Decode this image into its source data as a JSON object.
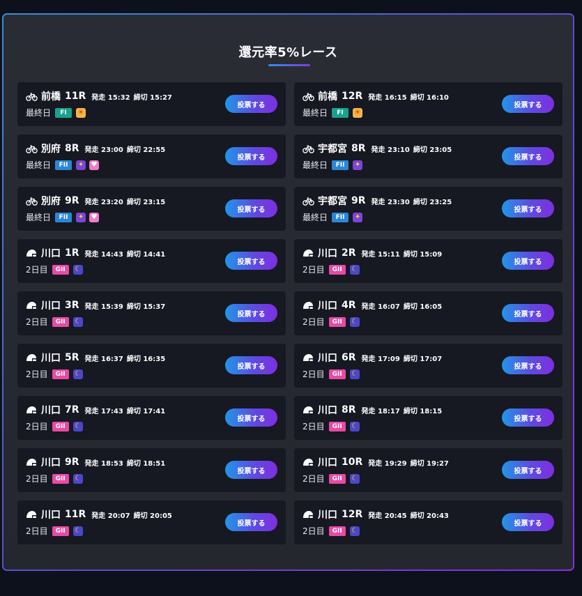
{
  "title": "還元率5%レース",
  "bet_label": "投票する",
  "colors": {
    "FI": "#17a38f",
    "FII": "#2a87d8",
    "GII": "#e84aa3",
    "sun": "#f5b445",
    "star": "#7b45d6",
    "heart": "#f07cc8",
    "moon": "#4c47c7"
  },
  "races": [
    {
      "icon": "bicycle-icon",
      "venue": "前橋",
      "race": "11R",
      "start": "発走 15:32",
      "deadline": "締切 15:27",
      "day": "最終日",
      "grade": "FI",
      "badges": [
        {
          "icon": "sun-icon",
          "color": "#f5b445",
          "glyph": "☀"
        }
      ]
    },
    {
      "icon": "bicycle-icon",
      "venue": "前橋",
      "race": "12R",
      "start": "発走 16:15",
      "deadline": "締切 16:10",
      "day": "最終日",
      "grade": "FI",
      "badges": [
        {
          "icon": "sun-icon",
          "color": "#f5b445",
          "glyph": "☀"
        }
      ]
    },
    {
      "icon": "bicycle-icon",
      "venue": "別府",
      "race": "8R",
      "start": "発走 23:00",
      "deadline": "締切 22:55",
      "day": "最終日",
      "grade": "FII",
      "badges": [
        {
          "icon": "midnight-icon",
          "color": "#7b45d6",
          "glyph": "✦"
        },
        {
          "icon": "heart-icon",
          "color": "#f07cc8",
          "glyph": "♥"
        }
      ]
    },
    {
      "icon": "bicycle-icon",
      "venue": "宇都宮",
      "race": "8R",
      "start": "発走 23:10",
      "deadline": "締切 23:05",
      "day": "最終日",
      "grade": "FII",
      "badges": [
        {
          "icon": "midnight-icon",
          "color": "#7b45d6",
          "glyph": "✦"
        }
      ]
    },
    {
      "icon": "bicycle-icon",
      "venue": "別府",
      "race": "9R",
      "start": "発走 23:20",
      "deadline": "締切 23:15",
      "day": "最終日",
      "grade": "FII",
      "badges": [
        {
          "icon": "midnight-icon",
          "color": "#7b45d6",
          "glyph": "✦"
        },
        {
          "icon": "heart-icon",
          "color": "#f07cc8",
          "glyph": "♥"
        }
      ]
    },
    {
      "icon": "bicycle-icon",
      "venue": "宇都宮",
      "race": "9R",
      "start": "発走 23:30",
      "deadline": "締切 23:25",
      "day": "最終日",
      "grade": "FII",
      "badges": [
        {
          "icon": "midnight-icon",
          "color": "#7b45d6",
          "glyph": "✦"
        }
      ]
    },
    {
      "icon": "helmet-icon",
      "venue": "川口",
      "race": "1R",
      "start": "発走 14:43",
      "deadline": "締切 14:41",
      "day": "2日目",
      "grade": "GII",
      "badges": [
        {
          "icon": "moon-icon",
          "color": "#4c47c7",
          "glyph": "☾"
        }
      ]
    },
    {
      "icon": "helmet-icon",
      "venue": "川口",
      "race": "2R",
      "start": "発走 15:11",
      "deadline": "締切 15:09",
      "day": "2日目",
      "grade": "GII",
      "badges": [
        {
          "icon": "moon-icon",
          "color": "#4c47c7",
          "glyph": "☾"
        }
      ]
    },
    {
      "icon": "helmet-icon",
      "venue": "川口",
      "race": "3R",
      "start": "発走 15:39",
      "deadline": "締切 15:37",
      "day": "2日目",
      "grade": "GII",
      "badges": [
        {
          "icon": "moon-icon",
          "color": "#4c47c7",
          "glyph": "☾"
        }
      ]
    },
    {
      "icon": "helmet-icon",
      "venue": "川口",
      "race": "4R",
      "start": "発走 16:07",
      "deadline": "締切 16:05",
      "day": "2日目",
      "grade": "GII",
      "badges": [
        {
          "icon": "moon-icon",
          "color": "#4c47c7",
          "glyph": "☾"
        }
      ]
    },
    {
      "icon": "helmet-icon",
      "venue": "川口",
      "race": "5R",
      "start": "発走 16:37",
      "deadline": "締切 16:35",
      "day": "2日目",
      "grade": "GII",
      "badges": [
        {
          "icon": "moon-icon",
          "color": "#4c47c7",
          "glyph": "☾"
        }
      ]
    },
    {
      "icon": "helmet-icon",
      "venue": "川口",
      "race": "6R",
      "start": "発走 17:09",
      "deadline": "締切 17:07",
      "day": "2日目",
      "grade": "GII",
      "badges": [
        {
          "icon": "moon-icon",
          "color": "#4c47c7",
          "glyph": "☾"
        }
      ]
    },
    {
      "icon": "helmet-icon",
      "venue": "川口",
      "race": "7R",
      "start": "発走 17:43",
      "deadline": "締切 17:41",
      "day": "2日目",
      "grade": "GII",
      "badges": [
        {
          "icon": "moon-icon",
          "color": "#4c47c7",
          "glyph": "☾"
        }
      ]
    },
    {
      "icon": "helmet-icon",
      "venue": "川口",
      "race": "8R",
      "start": "発走 18:17",
      "deadline": "締切 18:15",
      "day": "2日目",
      "grade": "GII",
      "badges": [
        {
          "icon": "moon-icon",
          "color": "#4c47c7",
          "glyph": "☾"
        }
      ]
    },
    {
      "icon": "helmet-icon",
      "venue": "川口",
      "race": "9R",
      "start": "発走 18:53",
      "deadline": "締切 18:51",
      "day": "2日目",
      "grade": "GII",
      "badges": [
        {
          "icon": "moon-icon",
          "color": "#4c47c7",
          "glyph": "☾"
        }
      ]
    },
    {
      "icon": "helmet-icon",
      "venue": "川口",
      "race": "10R",
      "start": "発走 19:29",
      "deadline": "締切 19:27",
      "day": "2日目",
      "grade": "GII",
      "badges": [
        {
          "icon": "moon-icon",
          "color": "#4c47c7",
          "glyph": "☾"
        }
      ]
    },
    {
      "icon": "helmet-icon",
      "venue": "川口",
      "race": "11R",
      "start": "発走 20:07",
      "deadline": "締切 20:05",
      "day": "2日目",
      "grade": "GII",
      "badges": [
        {
          "icon": "moon-icon",
          "color": "#4c47c7",
          "glyph": "☾"
        }
      ]
    },
    {
      "icon": "helmet-icon",
      "venue": "川口",
      "race": "12R",
      "start": "発走 20:45",
      "deadline": "締切 20:43",
      "day": "2日目",
      "grade": "GII",
      "badges": [
        {
          "icon": "moon-icon",
          "color": "#4c47c7",
          "glyph": "☾"
        }
      ]
    }
  ]
}
